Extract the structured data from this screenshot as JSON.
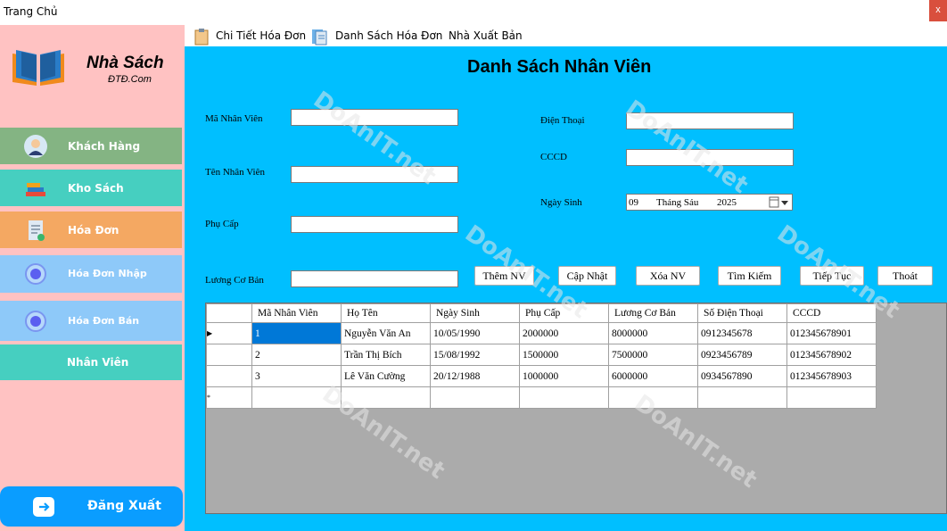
{
  "window": {
    "title": "Trang Chủ",
    "close_label": "x"
  },
  "sidebar": {
    "brand": "Nhà Sách",
    "brand_sub": "ĐTĐ.Com",
    "items": [
      {
        "label": "Khách Hàng",
        "icon": "customer-avatar-icon"
      },
      {
        "label": "Kho Sách",
        "icon": "books-stack-icon"
      },
      {
        "label": "Hóa Đơn",
        "icon": "invoice-icon"
      },
      {
        "label": "Hóa Đơn Nhập",
        "icon": "radio-circle-icon"
      },
      {
        "label": "Hóa Đơn Bán",
        "icon": "radio-circle-icon"
      },
      {
        "label": "Nhân Viên",
        "icon": ""
      }
    ],
    "logout": "Đăng Xuất"
  },
  "menustrip": {
    "items": [
      {
        "label": "Chi Tiết Hóa Đơn",
        "icon": "clipboard-icon"
      },
      {
        "label": "Danh Sách Hóa Đơn",
        "icon": "document-list-icon"
      },
      {
        "label": "Nhà Xuất Bản",
        "icon": ""
      }
    ]
  },
  "main": {
    "title": "Danh Sách Nhân Viên",
    "fields": {
      "ma_nv": {
        "label": "Mã Nhân Viên",
        "value": ""
      },
      "ten_nv": {
        "label": "Tên Nhân Viên",
        "value": ""
      },
      "phu_cap": {
        "label": "Phụ Cấp",
        "value": ""
      },
      "luong": {
        "label": "Lương Cơ Bản",
        "value": ""
      },
      "dien_thoai": {
        "label": "Điện Thoại",
        "value": ""
      },
      "cccd": {
        "label": "CCCD",
        "value": ""
      },
      "ngay_sinh": {
        "label": "Ngày Sinh",
        "day": "09",
        "month": "Tháng Sáu",
        "year": "2025"
      }
    },
    "buttons": {
      "them": "Thêm NV",
      "capnhat": "Cập Nhật",
      "xoa": "Xóa NV",
      "timkiem": "Tìm Kiếm",
      "tieptuc": "Tiếp Tục",
      "thoat": "Thoát"
    },
    "grid": {
      "columns": [
        "Mã Nhân Viên",
        "Họ Tên",
        "Ngày Sinh",
        "Phụ Cấp",
        "Lương Cơ Bản",
        "Số Điện Thoại",
        "CCCD"
      ],
      "rows": [
        [
          "1",
          "Nguyễn Văn An",
          "10/05/1990",
          "2000000",
          "8000000",
          "0912345678",
          "012345678901"
        ],
        [
          "2",
          "Trần Thị Bích",
          "15/08/1992",
          "1500000",
          "7500000",
          "0923456789",
          "012345678902"
        ],
        [
          "3",
          "Lê Văn Cường",
          "20/12/1988",
          "1000000",
          "6000000",
          "0934567890",
          "012345678903"
        ]
      ],
      "current_marker": "▶",
      "new_row_marker": "*"
    },
    "watermark": "DoAnIT.net"
  },
  "colors": {
    "main_bg": "#00bfff",
    "sidebar_bg": "#ffc2c2",
    "khach_hang": "#84b483",
    "kho_sach": "#46cfc0",
    "hoa_don": "#f4a862",
    "hoa_don_nhap_ban": "#8ec9f9",
    "logout": "#0a9dff",
    "selected_cell": "#0078d7"
  }
}
